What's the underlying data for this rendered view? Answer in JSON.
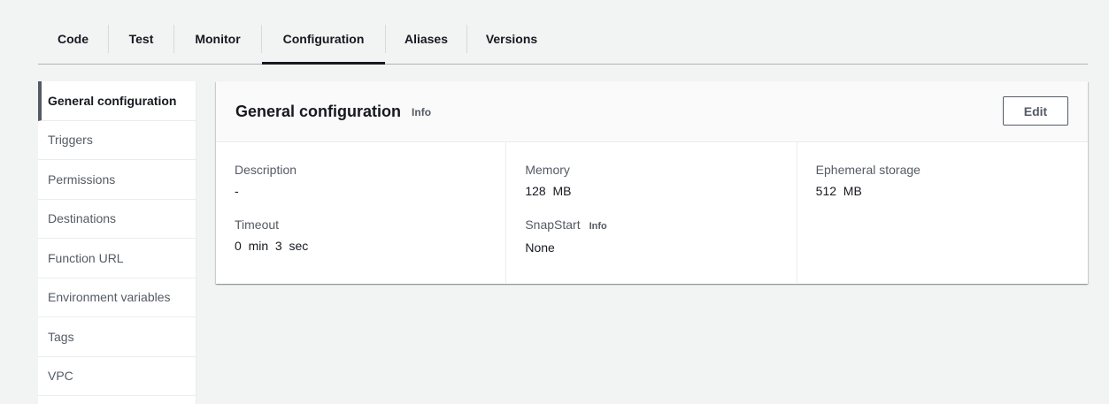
{
  "tabs": [
    {
      "label": "Code"
    },
    {
      "label": "Test"
    },
    {
      "label": "Monitor"
    },
    {
      "label": "Configuration"
    },
    {
      "label": "Aliases"
    },
    {
      "label": "Versions"
    }
  ],
  "active_tab": "Configuration",
  "sidebar": {
    "items": [
      {
        "label": "General configuration"
      },
      {
        "label": "Triggers"
      },
      {
        "label": "Permissions"
      },
      {
        "label": "Destinations"
      },
      {
        "label": "Function URL"
      },
      {
        "label": "Environment variables"
      },
      {
        "label": "Tags"
      },
      {
        "label": "VPC"
      }
    ],
    "active": "General configuration"
  },
  "panel": {
    "title": "General configuration",
    "info_label": "Info",
    "edit_label": "Edit",
    "fields": {
      "description": {
        "label": "Description",
        "value": "-"
      },
      "timeout": {
        "label": "Timeout",
        "value": "0  min  3  sec"
      },
      "memory": {
        "label": "Memory",
        "value": "128  MB"
      },
      "snapstart": {
        "label": "SnapStart",
        "info_label": "Info",
        "value": "None"
      },
      "ephemeral_storage": {
        "label": "Ephemeral storage",
        "value": "512  MB"
      }
    }
  },
  "colors": {
    "background": "#f2f3f3",
    "text_primary": "#16191f",
    "text_secondary": "#545b64",
    "divider": "#eaeded"
  }
}
